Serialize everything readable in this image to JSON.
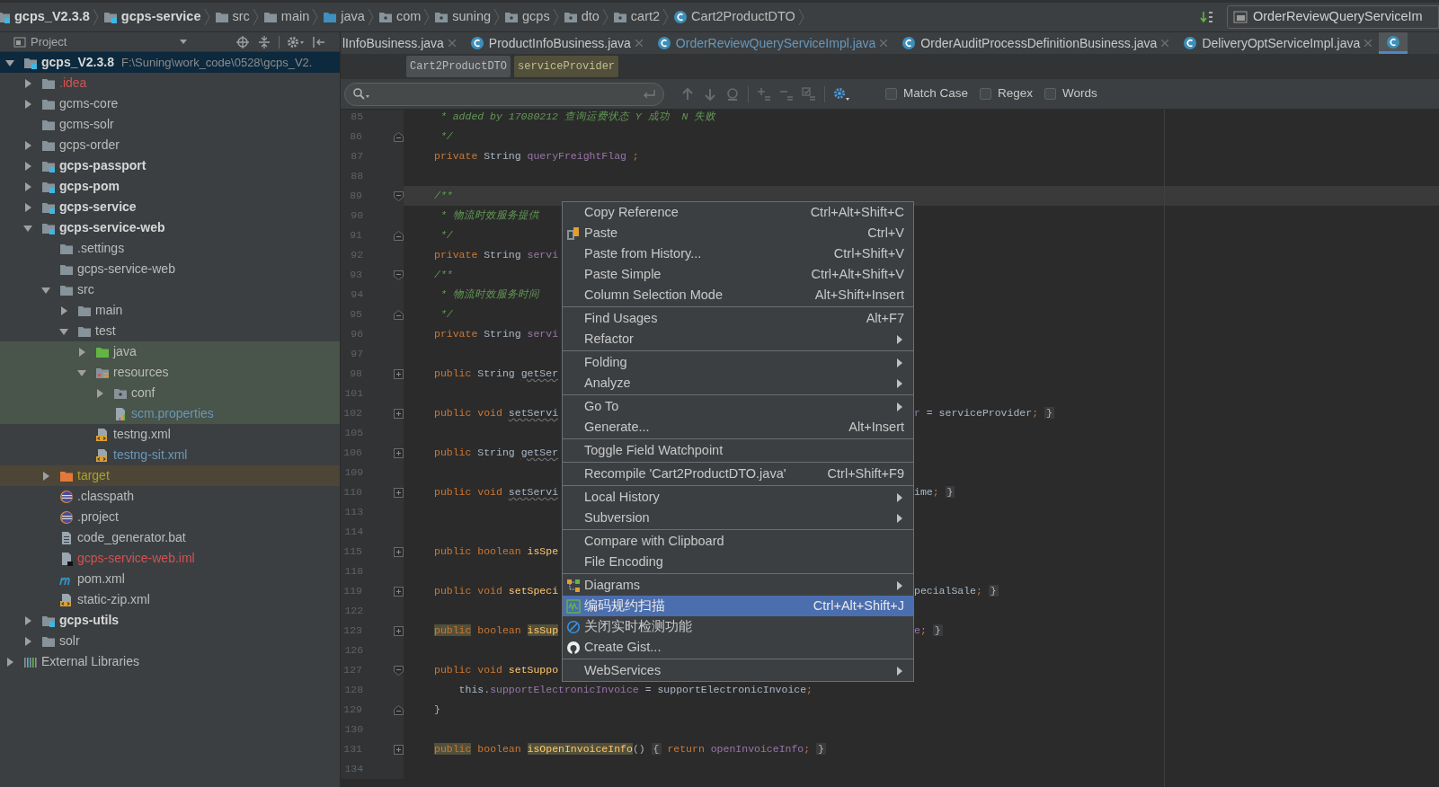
{
  "breadcrumb": [
    {
      "label": "gcps_V2.3.8",
      "kind": "module",
      "bold": true
    },
    {
      "label": "gcps-service",
      "kind": "module",
      "bold": true
    },
    {
      "label": "src",
      "kind": "folder",
      "bold": false
    },
    {
      "label": "main",
      "kind": "folder",
      "bold": false
    },
    {
      "label": "java",
      "kind": "source",
      "bold": false
    },
    {
      "label": "com",
      "kind": "package",
      "bold": false
    },
    {
      "label": "suning",
      "kind": "package",
      "bold": false
    },
    {
      "label": "gcps",
      "kind": "package",
      "bold": false
    },
    {
      "label": "dto",
      "kind": "package",
      "bold": false
    },
    {
      "label": "cart2",
      "kind": "package",
      "bold": false
    },
    {
      "label": "Cart2ProductDTO",
      "kind": "class",
      "bold": false
    }
  ],
  "navigation_field": {
    "value": "OrderReviewQueryServiceIm"
  },
  "project_panel": {
    "title": "Project"
  },
  "tree": [
    {
      "label": "gcps_V2.3.8",
      "detail": "F:\\Suning\\work_code\\0528\\gcps_V2.",
      "kind": "module",
      "bold": true,
      "expanded": true,
      "selected": true,
      "children": [
        {
          "label": ".idea",
          "kind": "folder",
          "bold": false,
          "expanded": false,
          "selected": false,
          "color": "#d25252"
        },
        {
          "label": "gcms-core",
          "kind": "folder",
          "bold": false,
          "expanded": false,
          "selected": false
        },
        {
          "label": "gcms-solr",
          "kind": "folder",
          "bold": false,
          "selected": false
        },
        {
          "label": "gcps-order",
          "kind": "folder",
          "bold": false,
          "expanded": false,
          "selected": false
        },
        {
          "label": "gcps-passport",
          "kind": "module",
          "bold": true,
          "expanded": false,
          "selected": false
        },
        {
          "label": "gcps-pom",
          "kind": "module",
          "bold": true,
          "expanded": false,
          "selected": false
        },
        {
          "label": "gcps-service",
          "kind": "module",
          "bold": true,
          "expanded": false,
          "selected": false
        },
        {
          "label": "gcps-service-web",
          "kind": "module",
          "bold": true,
          "expanded": true,
          "selected": false,
          "children": [
            {
              "label": ".settings",
              "kind": "folder",
              "bold": false,
              "selected": false
            },
            {
              "label": "gcps-service-web",
              "kind": "folder",
              "bold": false,
              "selected": false
            },
            {
              "label": "src",
              "kind": "folder",
              "bold": false,
              "expanded": true,
              "selected": false,
              "children": [
                {
                  "label": "main",
                  "kind": "folder",
                  "bold": false,
                  "expanded": false,
                  "selected": false
                },
                {
                  "label": "test",
                  "kind": "folder",
                  "bold": false,
                  "expanded": true,
                  "selected": false,
                  "children": [
                    {
                      "label": "java",
                      "kind": "test_source",
                      "bold": false,
                      "expanded": false,
                      "selected": false,
                      "highlighted": true
                    },
                    {
                      "label": "resources",
                      "kind": "resources",
                      "bold": false,
                      "expanded": true,
                      "selected": false,
                      "highlighted": true,
                      "children": [
                        {
                          "label": "conf",
                          "kind": "package",
                          "bold": false,
                          "expanded": false,
                          "selected": false,
                          "highlighted": true
                        },
                        {
                          "label": "scm.properties",
                          "kind": "properties",
                          "bold": false,
                          "selected": false,
                          "highlighted": true,
                          "color": "#6897bb"
                        }
                      ]
                    },
                    {
                      "label": "testng.xml",
                      "kind": "xml",
                      "bold": false,
                      "selected": false
                    },
                    {
                      "label": "testng-sit.xml",
                      "kind": "xml",
                      "bold": false,
                      "selected": false,
                      "color": "#6897bb"
                    }
                  ]
                }
              ]
            },
            {
              "label": "target",
              "kind": "excluded",
              "bold": false,
              "expanded": false,
              "selected": false,
              "highlighted": true,
              "color": "#a8a22e"
            },
            {
              "label": ".classpath",
              "kind": "eclipse",
              "bold": false,
              "selected": false
            },
            {
              "label": ".project",
              "kind": "eclipse",
              "bold": false,
              "selected": false
            },
            {
              "label": "code_generator.bat",
              "kind": "file",
              "bold": false,
              "selected": false
            },
            {
              "label": "gcps-service-web.iml",
              "kind": "iml",
              "bold": false,
              "selected": false,
              "color": "#d25252"
            },
            {
              "label": "pom.xml",
              "kind": "maven",
              "bold": false,
              "selected": false
            },
            {
              "label": "static-zip.xml",
              "kind": "xml",
              "bold": false,
              "selected": false
            }
          ]
        },
        {
          "label": "gcps-utils",
          "kind": "module",
          "bold": true,
          "expanded": false,
          "selected": false
        },
        {
          "label": "solr",
          "kind": "folder",
          "bold": false,
          "expanded": false,
          "selected": false
        }
      ]
    },
    {
      "label": "External Libraries",
      "kind": "libraries",
      "bold": false,
      "expanded": false,
      "selected": false
    }
  ],
  "tabs": [
    {
      "label": "lInfoBusiness.java",
      "selected": false
    },
    {
      "label": "ProductInfoBusiness.java",
      "selected": false
    },
    {
      "label": "OrderReviewQueryServiceImpl.java",
      "selected": false,
      "color": "#6897bb"
    },
    {
      "label": "OrderAuditProcessDefinitionBusiness.java",
      "selected": false
    },
    {
      "label": "DeliveryOptServiceImpl.java",
      "selected": false
    },
    {
      "selected": true
    }
  ],
  "chips": [
    {
      "label": "Cart2ProductDTO",
      "kind": "class"
    },
    {
      "label": "serviceProvider",
      "kind": "field"
    }
  ],
  "search": {
    "options": [
      {
        "label": "Match Case",
        "checked": false
      },
      {
        "label": "Regex",
        "checked": false
      },
      {
        "label": "Words",
        "checked": false
      }
    ]
  },
  "code_lines": [
    {
      "number": "85",
      "current": false,
      "tokens": [
        {
          "text": " * added by 17080212 查询运费状态 Y 成功  N 失败",
          "kind": "doc"
        }
      ]
    },
    {
      "number": "86",
      "current": false,
      "kind": "close",
      "tokens": [
        {
          "text": " */",
          "kind": "doc"
        }
      ]
    },
    {
      "number": "87",
      "current": false,
      "tokens": [
        {
          "text": "private ",
          "kind": "kw"
        },
        {
          "text": "String ",
          "kind": "plain"
        },
        {
          "text": "queryFreightFlag",
          "kind": "field"
        },
        {
          "text": " ;",
          "kind": "kw"
        }
      ]
    },
    {
      "number": "88",
      "current": false
    },
    {
      "number": "89",
      "current": true,
      "kind": "open",
      "tokens": [
        {
          "text": "/**",
          "kind": "doc"
        }
      ]
    },
    {
      "number": "90",
      "current": false,
      "tokens": [
        {
          "text": " * 物流时效服务提供",
          "kind": "doc"
        }
      ]
    },
    {
      "number": "91",
      "current": false,
      "kind": "close",
      "tokens": [
        {
          "text": " */",
          "kind": "doc"
        }
      ]
    },
    {
      "number": "92",
      "current": false,
      "tokens": [
        {
          "text": "private ",
          "kind": "kw"
        },
        {
          "text": "String ",
          "kind": "plain"
        },
        {
          "text": "servi",
          "kind": "field"
        }
      ]
    },
    {
      "number": "93",
      "current": false,
      "kind": "open",
      "tokens": [
        {
          "text": "/**",
          "kind": "doc"
        }
      ]
    },
    {
      "number": "94",
      "current": false,
      "tokens": [
        {
          "text": " * 物流时效服务时间",
          "kind": "doc"
        }
      ]
    },
    {
      "number": "95",
      "current": false,
      "kind": "close",
      "tokens": [
        {
          "text": " */",
          "kind": "doc"
        }
      ]
    },
    {
      "number": "96",
      "current": false,
      "tokens": [
        {
          "text": "private ",
          "kind": "kw"
        },
        {
          "text": "String ",
          "kind": "plain"
        },
        {
          "text": "servi",
          "kind": "field"
        }
      ]
    },
    {
      "number": "97",
      "current": false
    },
    {
      "number": "98",
      "current": false,
      "kind": "plus",
      "tokens": [
        {
          "text": "public ",
          "kind": "kw"
        },
        {
          "text": "String ",
          "kind": "plain"
        },
        {
          "text": "getSer",
          "kind": "unused"
        }
      ]
    },
    {
      "number": "101",
      "current": false
    },
    {
      "number": "102",
      "current": false,
      "kind": "plus",
      "tokens": [
        {
          "text": "public void ",
          "kind": "kw"
        },
        {
          "text": "setServi",
          "kind": "unused"
        }
      ],
      "tail": [
        {
          "text": "r",
          "kind": "field"
        },
        {
          "text": " = serviceProvider",
          "kind": "plain"
        },
        {
          "text": "; ",
          "kind": "kw"
        },
        {
          "text": "}",
          "kind": "fold"
        }
      ]
    },
    {
      "number": "105",
      "current": false
    },
    {
      "number": "106",
      "current": false,
      "kind": "plus",
      "tokens": [
        {
          "text": "public ",
          "kind": "kw"
        },
        {
          "text": "String ",
          "kind": "plain"
        },
        {
          "text": "getSer",
          "kind": "unused"
        }
      ]
    },
    {
      "number": "109",
      "current": false
    },
    {
      "number": "110",
      "current": false,
      "kind": "plus",
      "tokens": [
        {
          "text": "public void ",
          "kind": "kw"
        },
        {
          "text": "setServi",
          "kind": "unused"
        }
      ],
      "tail": [
        {
          "text": "ime",
          "kind": "plain"
        },
        {
          "text": "; ",
          "kind": "kw"
        },
        {
          "text": "}",
          "kind": "fold"
        }
      ]
    },
    {
      "number": "113",
      "current": false
    },
    {
      "number": "114",
      "current": false
    },
    {
      "number": "115",
      "current": false,
      "kind": "plus",
      "tokens": [
        {
          "text": "public boolean ",
          "kind": "kw"
        },
        {
          "text": "isSpe",
          "kind": "method"
        }
      ]
    },
    {
      "number": "118",
      "current": false
    },
    {
      "number": "119",
      "current": false,
      "kind": "plus",
      "tokens": [
        {
          "text": "public void ",
          "kind": "kw"
        },
        {
          "text": "setSpeci",
          "kind": "method"
        }
      ],
      "tail": [
        {
          "text": "pecialSale",
          "kind": "plain"
        },
        {
          "text": "; ",
          "kind": "kw"
        },
        {
          "text": "}",
          "kind": "fold"
        }
      ]
    },
    {
      "number": "122",
      "current": false
    },
    {
      "number": "123",
      "current": false,
      "kind": "plus",
      "tokens": [
        {
          "text": "public",
          "kind": "hl"
        },
        {
          "text": " boolean ",
          "kind": "kw"
        },
        {
          "text": "isSup",
          "kind": "hlm"
        }
      ],
      "tail": [
        {
          "text": "e",
          "kind": "field"
        },
        {
          "text": "; ",
          "kind": "kw"
        },
        {
          "text": "}",
          "kind": "fold"
        }
      ]
    },
    {
      "number": "126",
      "current": false
    },
    {
      "number": "127",
      "current": false,
      "kind": "open",
      "tokens": [
        {
          "text": "public void ",
          "kind": "kw"
        },
        {
          "text": "setSuppo",
          "kind": "method"
        }
      ]
    },
    {
      "number": "128",
      "current": false,
      "tokens": [
        {
          "text": "    this.",
          "kind": "plain"
        },
        {
          "text": "supportElectronicInvoice",
          "kind": "field"
        },
        {
          "text": " = supportElectronicInvoice",
          "kind": "plain"
        },
        {
          "text": ";",
          "kind": "kw"
        }
      ]
    },
    {
      "number": "129",
      "current": false,
      "kind": "close",
      "tokens": [
        {
          "text": "}",
          "kind": "plain"
        }
      ]
    },
    {
      "number": "130",
      "current": false
    },
    {
      "number": "131",
      "current": false,
      "kind": "plus",
      "tokens": [
        {
          "text": "public",
          "kind": "hl"
        },
        {
          "text": " boolean ",
          "kind": "kw"
        },
        {
          "text": "isOpenInvoiceInfo",
          "kind": "hlm"
        },
        {
          "text": "() ",
          "kind": "plain"
        },
        {
          "text": "{",
          "kind": "fold"
        },
        {
          "text": " return ",
          "kind": "kw"
        },
        {
          "text": "openInvoiceInfo",
          "kind": "field"
        },
        {
          "text": "; ",
          "kind": "kw"
        },
        {
          "text": "}",
          "kind": "fold"
        }
      ]
    },
    {
      "number": "134",
      "current": false
    }
  ],
  "context_menu": {
    "groups": [
      {
        "items": [
          {
            "label": "Copy Reference",
            "shortcut": "Ctrl+Alt+Shift+C",
            "submenu": false,
            "selected": false
          },
          {
            "label": "Paste",
            "shortcut": "Ctrl+V",
            "submenu": false,
            "selected": false,
            "kind": "paste"
          },
          {
            "label": "Paste from History...",
            "shortcut": "Ctrl+Shift+V",
            "submenu": false,
            "selected": false
          },
          {
            "label": "Paste Simple",
            "shortcut": "Ctrl+Alt+Shift+V",
            "submenu": false,
            "selected": false
          },
          {
            "label": "Column Selection Mode",
            "shortcut": "Alt+Shift+Insert",
            "submenu": false,
            "selected": false
          }
        ]
      },
      {
        "items": [
          {
            "label": "Find Usages",
            "shortcut": "Alt+F7",
            "submenu": false,
            "selected": false
          },
          {
            "label": "Refactor",
            "submenu": true,
            "selected": false
          }
        ]
      },
      {
        "items": [
          {
            "label": "Folding",
            "submenu": true,
            "selected": false
          },
          {
            "label": "Analyze",
            "submenu": true,
            "selected": false
          }
        ]
      },
      {
        "items": [
          {
            "label": "Go To",
            "submenu": true,
            "selected": false
          },
          {
            "label": "Generate...",
            "shortcut": "Alt+Insert",
            "submenu": false,
            "selected": false
          }
        ]
      },
      {
        "items": [
          {
            "label": "Toggle Field Watchpoint",
            "submenu": false,
            "selected": false
          }
        ]
      },
      {
        "items": [
          {
            "label": "Recompile 'Cart2ProductDTO.java'",
            "shortcut": "Ctrl+Shift+F9",
            "submenu": false,
            "selected": false
          }
        ]
      },
      {
        "items": [
          {
            "label": "Local History",
            "submenu": true,
            "selected": false
          },
          {
            "label": "Subversion",
            "submenu": true,
            "selected": false
          }
        ]
      },
      {
        "items": [
          {
            "label": "Compare with Clipboard",
            "submenu": false,
            "selected": false
          },
          {
            "label": "File Encoding",
            "submenu": false,
            "selected": false
          }
        ]
      },
      {
        "items": [
          {
            "label": "Diagrams",
            "submenu": true,
            "selected": false,
            "kind": "diagram"
          },
          {
            "label": "编码规约扫描",
            "shortcut": "Ctrl+Alt+Shift+J",
            "submenu": false,
            "selected": true,
            "kind": "scan"
          },
          {
            "label": "关闭实时检测功能",
            "submenu": false,
            "selected": false,
            "kind": "block"
          },
          {
            "label": "Create Gist...",
            "submenu": false,
            "selected": false,
            "kind": "gist"
          }
        ]
      },
      {
        "items": [
          {
            "label": "WebServices",
            "submenu": true,
            "selected": false
          }
        ]
      }
    ]
  }
}
